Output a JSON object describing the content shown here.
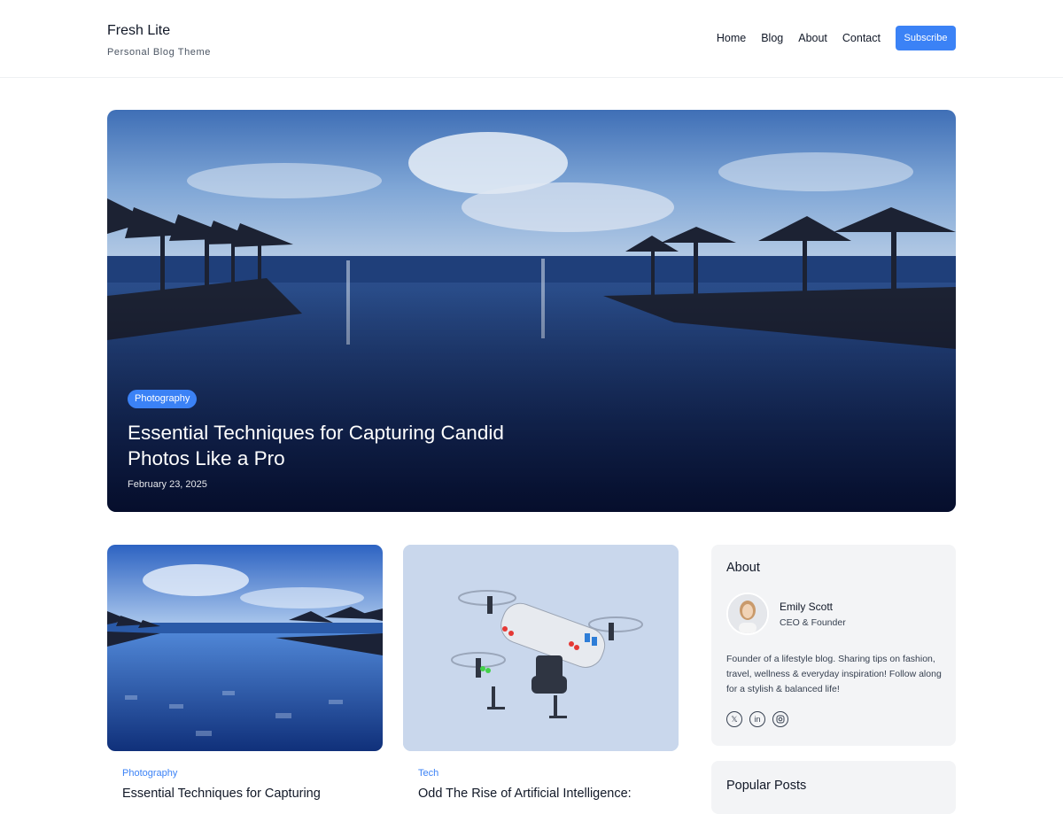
{
  "header": {
    "site_title": "Fresh Lite",
    "tagline": "Personal Blog Theme",
    "nav": [
      "Home",
      "Blog",
      "About",
      "Contact"
    ],
    "subscribe_label": "Subscribe"
  },
  "hero": {
    "category": "Photography",
    "title": "Essential Techniques for Capturing Candid Photos Like a Pro",
    "date": "February 23, 2025",
    "image_icon": "infinity-pool-photo"
  },
  "cards": [
    {
      "category": "Photography",
      "title": "Essential Techniques for Capturing",
      "image_icon": "pool-photo"
    },
    {
      "category": "Tech",
      "title": "Odd The Rise of Artificial Intelligence:",
      "image_icon": "drone-photo"
    }
  ],
  "sidebar": {
    "about": {
      "title": "About",
      "author_name": "Emily Scott",
      "author_role": "CEO & Founder",
      "bio": "Founder of a lifestyle blog. Sharing tips on fashion, travel, wellness & everyday inspiration! Follow along for a stylish & balanced life!",
      "socials": [
        "x-icon",
        "linkedin-icon",
        "instagram-icon"
      ]
    },
    "popular_title": "Popular Posts"
  },
  "colors": {
    "accent": "#3b82f6",
    "panel": "#f3f4f6"
  }
}
